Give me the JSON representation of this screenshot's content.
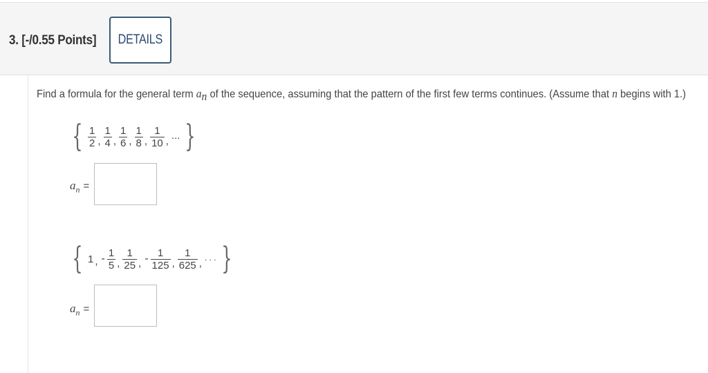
{
  "question": {
    "title": "3. [-/0.55 Points]",
    "details_label": "DETAILS"
  },
  "prompt": {
    "text_before": "Find a formula for the general term ",
    "term_var": "a",
    "term_sub": "n",
    "text_middle": " of the sequence, assuming that the pattern of the first few terms continues. (Assume that ",
    "n_var": "n",
    "text_after": " begins with 1.)"
  },
  "sequence_1": {
    "open_brace": "{",
    "close_brace": "}",
    "terms": [
      {
        "num": "1",
        "den": "2"
      },
      {
        "num": "1",
        "den": "4"
      },
      {
        "num": "1",
        "den": "6"
      },
      {
        "num": "1",
        "den": "8"
      },
      {
        "num": "1",
        "den": "10"
      }
    ],
    "separator": ",",
    "ellipsis": "..."
  },
  "sequence_2": {
    "first_term": "1",
    "minus": "-",
    "terms": [
      {
        "num": "1",
        "den": "5"
      },
      {
        "num": "1",
        "den": "25"
      },
      {
        "num": "1",
        "den": "125"
      },
      {
        "num": "1",
        "den": "625"
      }
    ],
    "separator": ",",
    "ellipsis": ". . ."
  },
  "answers": [
    {
      "label_var": "a",
      "label_sub": "n",
      "equals": "=",
      "value": ""
    },
    {
      "label_var": "a",
      "label_sub": "n",
      "equals": "=",
      "value": ""
    }
  ]
}
